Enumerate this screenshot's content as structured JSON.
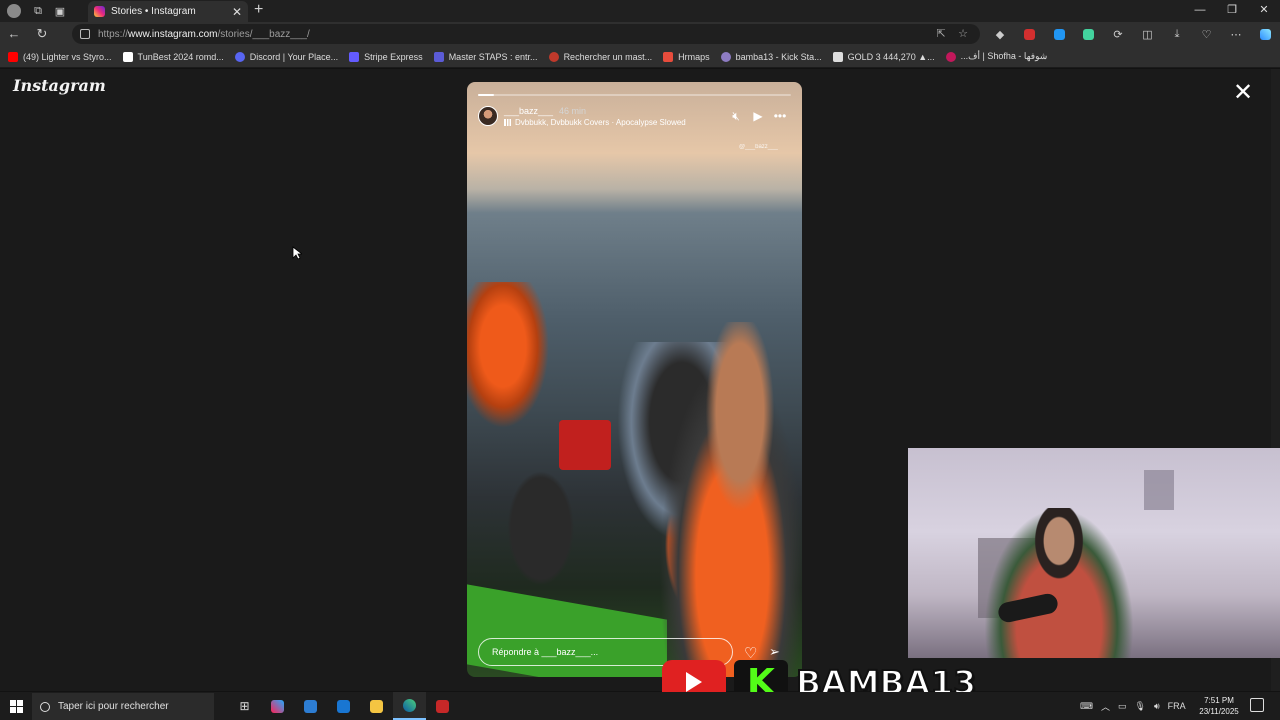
{
  "browser": {
    "tab_title": "Stories • Instagram",
    "url_prefix": "https://",
    "url_host": "www.instagram.com",
    "url_path": "/stories/___bazz___/"
  },
  "bookmarks": [
    {
      "label": "(49) Lighter vs Styro...",
      "color": "#ff0000"
    },
    {
      "label": "TunBest 2024 romd...",
      "color": "#ffffff"
    },
    {
      "label": "Discord | Your Place...",
      "color": "#5865f2"
    },
    {
      "label": "Stripe Express",
      "color": "#635bff"
    },
    {
      "label": "Master STAPS : entr...",
      "color": "#5b5bd6"
    },
    {
      "label": "Rechercher un mast...",
      "color": "#c0392b"
    },
    {
      "label": "Hrmaps",
      "color": "#e74c3c"
    },
    {
      "label": "bamba13 - Kick Sta...",
      "color": "#8e7cc3"
    },
    {
      "label": "GOLD 3 444,270 ▲...",
      "color": "#dddddd"
    },
    {
      "label": "...أف | Shofha - شوفها",
      "color": "#c2185b"
    }
  ],
  "page": {
    "logo": "Instagram",
    "close_label": "✕"
  },
  "story": {
    "username": "___bazz___",
    "time": "46 min",
    "music": "Dvbbukk, Dvbbukk Covers · Apocalypse Slowed",
    "sticker_line1": "@___bazz___",
    "sticker_line2": "",
    "progress": 0.05,
    "reply_placeholder": "Répondre à ___bazz___..."
  },
  "banner": {
    "kick_letter": "K",
    "streamer": "BAMBA13"
  },
  "taskbar": {
    "search_placeholder": "Taper ici pour rechercher",
    "language": "FRA",
    "time": "7:51 PM",
    "date": "23/11/2025"
  },
  "colors": {
    "youtube": "#e02121",
    "kick": "#53fc18"
  }
}
